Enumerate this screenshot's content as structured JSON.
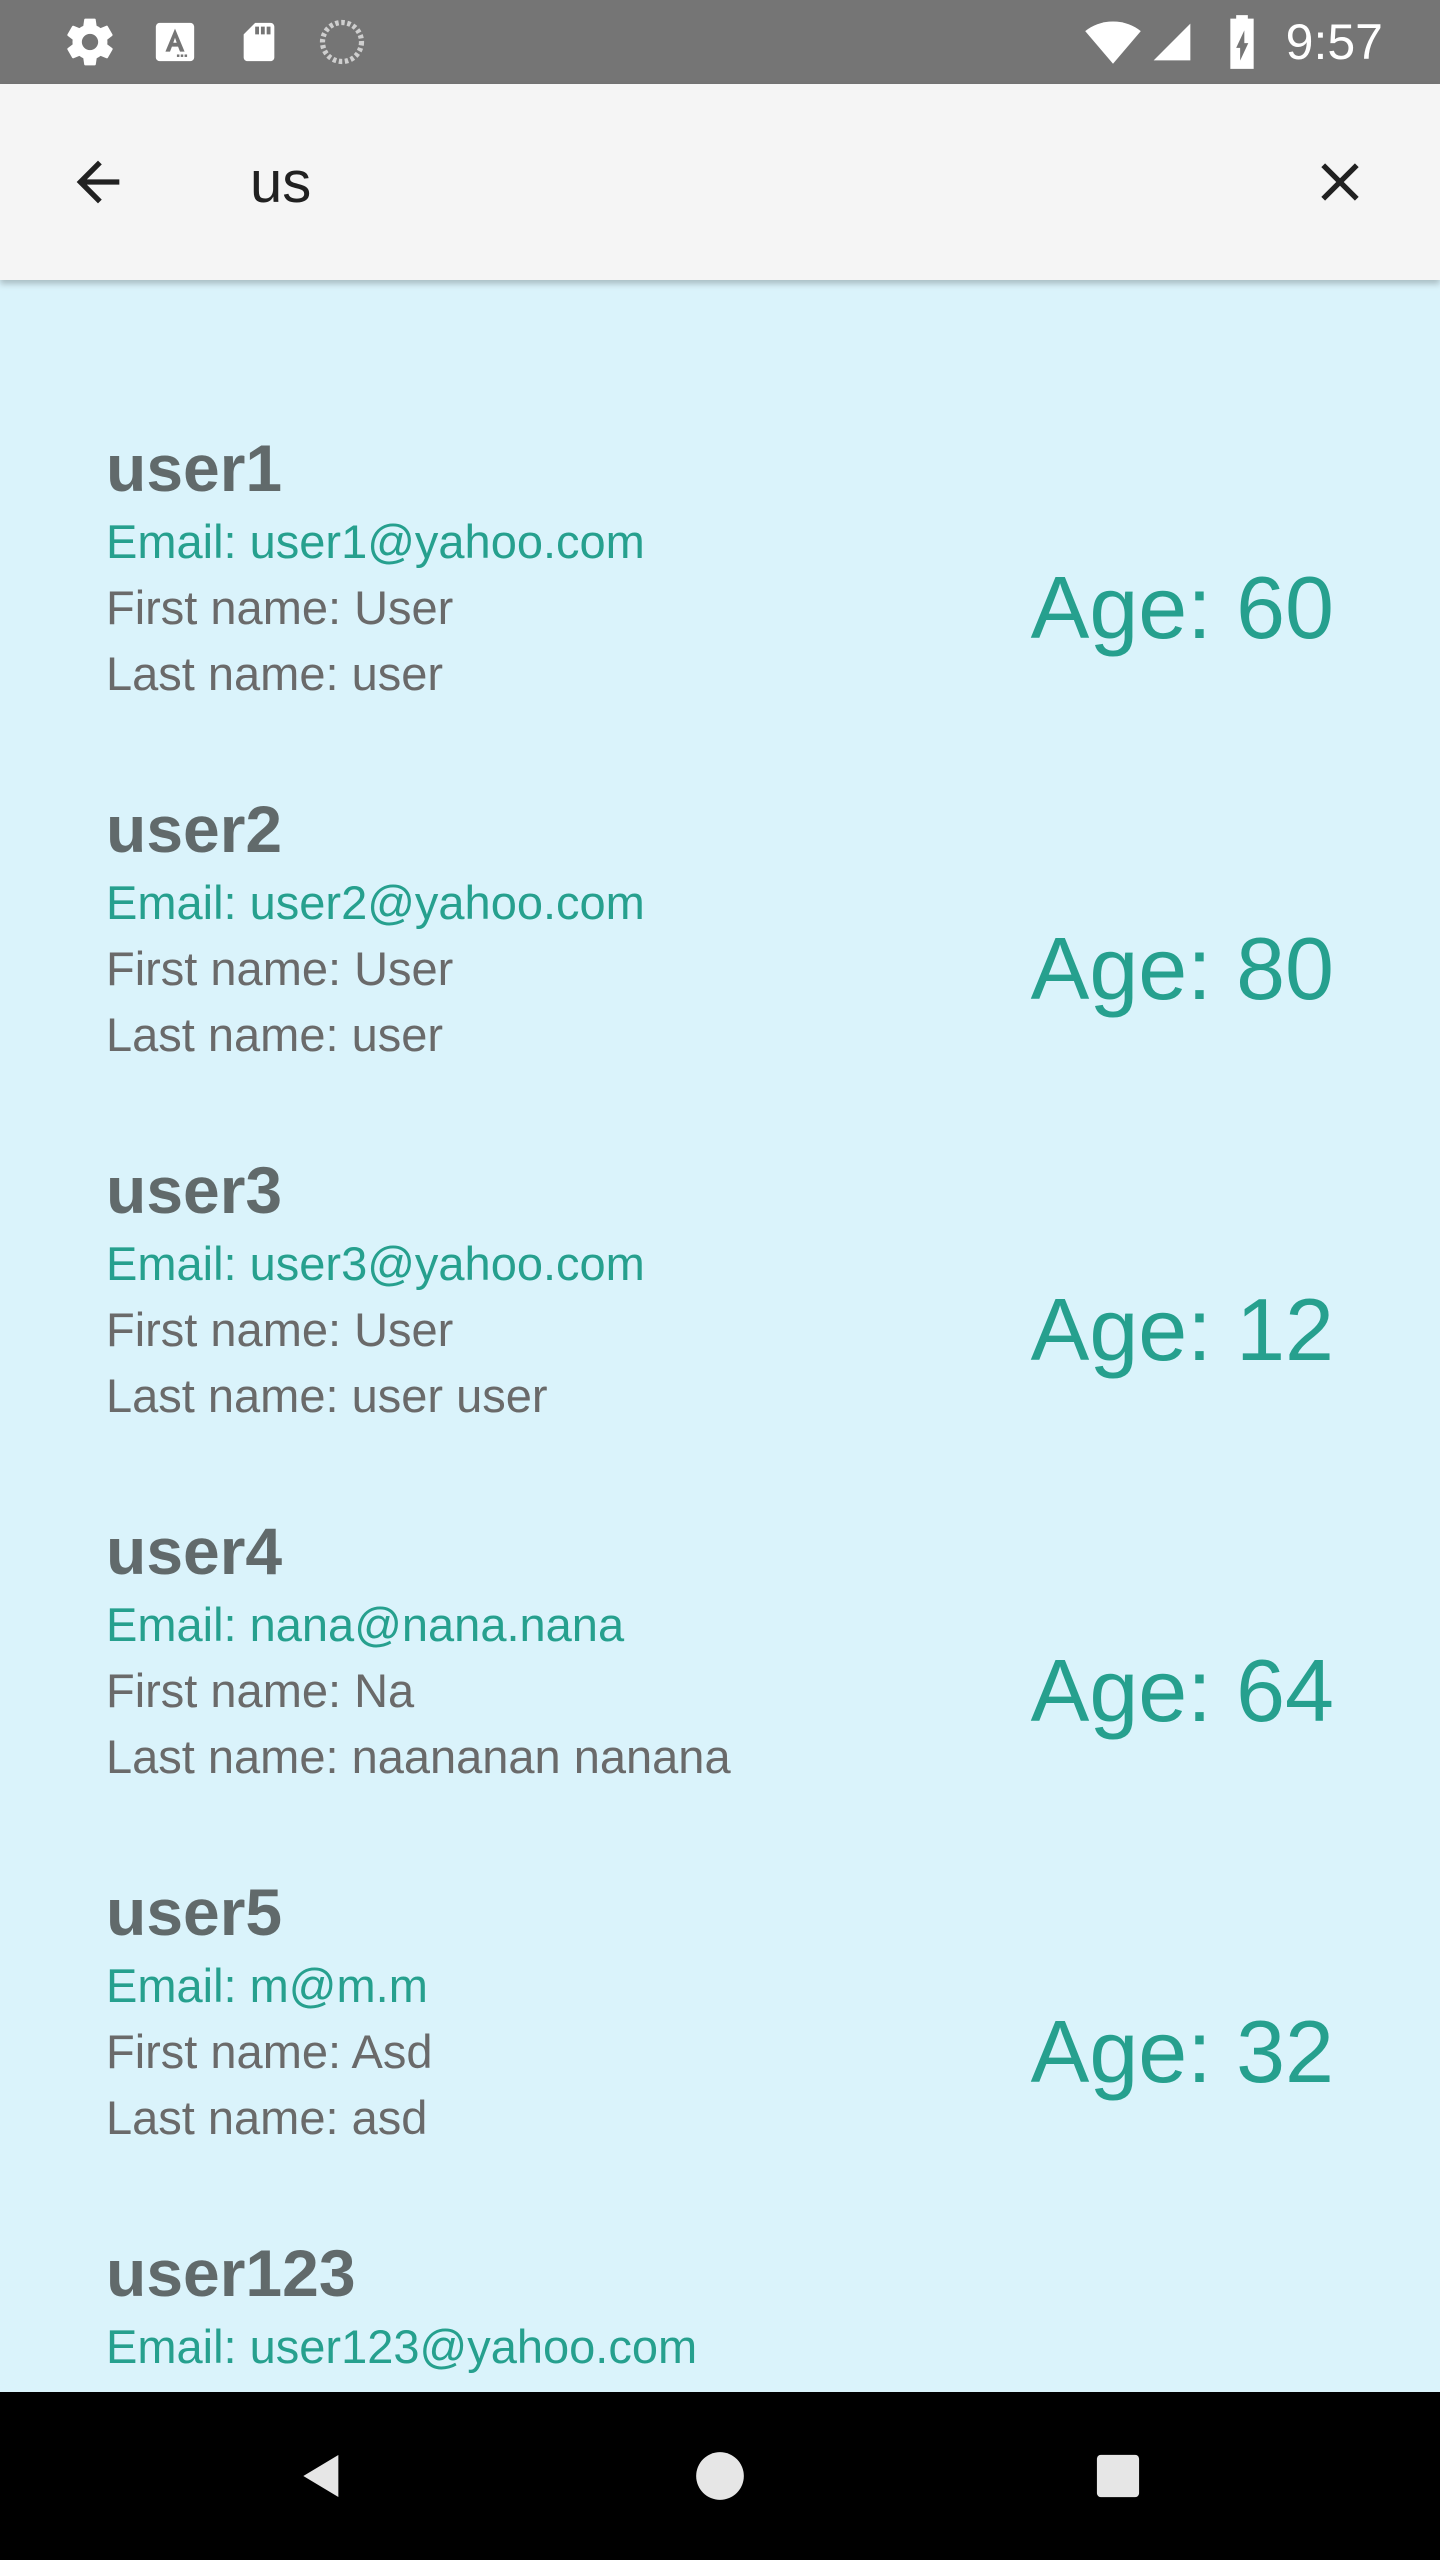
{
  "status_bar": {
    "time": "9:57",
    "icons": [
      "settings-icon",
      "a-icon",
      "sd-card-icon",
      "loading-icon",
      "wifi-icon",
      "signal-icon",
      "battery-charging-icon"
    ]
  },
  "search": {
    "query": "us",
    "back_icon": "arrow-back-icon",
    "clear_icon": "close-icon"
  },
  "users": [
    {
      "username": "user1",
      "email": "Email: user1@yahoo.com",
      "first_name": "First name: User",
      "last_name": "Last name: user",
      "age": "Age: 60"
    },
    {
      "username": "user2",
      "email": "Email: user2@yahoo.com",
      "first_name": "First name: User",
      "last_name": "Last name: user",
      "age": "Age: 80"
    },
    {
      "username": "user3",
      "email": "Email: user3@yahoo.com",
      "first_name": "First name: User",
      "last_name": "Last name: user user",
      "age": "Age: 12"
    },
    {
      "username": "user4",
      "email": "Email: nana@nana.nana",
      "first_name": "First name: Na",
      "last_name": "Last name: naananan nanana",
      "age": "Age: 64"
    },
    {
      "username": "user5",
      "email": "Email: m@m.m",
      "first_name": "First name: Asd",
      "last_name": "Last name: asd",
      "age": "Age: 32"
    },
    {
      "username": "user123",
      "email": "Email: user123@yahoo.com",
      "first_name": "",
      "last_name": "",
      "age": ""
    }
  ],
  "nav_bar": {
    "icons": [
      "back-triangle-icon",
      "home-circle-icon",
      "recents-square-icon"
    ]
  },
  "colors": {
    "status_bar": "#757575",
    "app_bar": "#F5F5F5",
    "list_background": "#DAF3FB",
    "accent_teal": "#26A08E",
    "username_gray": "#616A6B",
    "detail_gray": "#6A6A6A",
    "nav_bar": "#000000"
  }
}
